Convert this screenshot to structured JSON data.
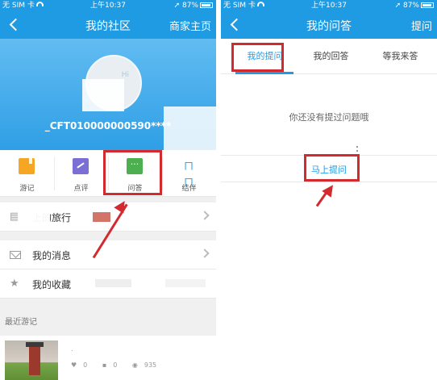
{
  "left_screen": {
    "status": {
      "carrier": "无 SIM 卡",
      "time": "上午10:37",
      "battery": "87%"
    },
    "nav": {
      "title": "我的社区",
      "right_action": "商家主页"
    },
    "profile": {
      "username": "_CFT010000000590****",
      "avatar_text": "Hi"
    },
    "grid": [
      {
        "label": "游记",
        "icon": "notes-icon"
      },
      {
        "label": "点评",
        "icon": "review-icon"
      },
      {
        "label": "问答",
        "icon": "qa-icon"
      },
      {
        "label": "结伴",
        "icon": "partner-icon"
      }
    ],
    "partner_icon_glyph": "ㄇㄇ",
    "list": [
      {
        "label": "上的旅行",
        "icon": "travel-icon"
      },
      {
        "label": "我的消息",
        "icon": "mail-icon"
      },
      {
        "label": "我的收藏",
        "icon": "star-icon"
      }
    ],
    "recent": {
      "section_title": "最近游记",
      "stats": {
        "likes": "0",
        "comments": "0",
        "views": "935"
      },
      "subtitle": "."
    }
  },
  "right_screen": {
    "status": {
      "carrier": "无 SIM 卡",
      "time": "上午10:37",
      "battery": "87%"
    },
    "nav": {
      "title": "我的问答",
      "right_action": "提问"
    },
    "tabs": [
      {
        "label": "我的提问",
        "active": true
      },
      {
        "label": "我的回答",
        "active": false
      },
      {
        "label": "等我来答",
        "active": false
      }
    ],
    "empty_message": "你还没有提过问题哦",
    "ask_button": "马上提问"
  },
  "colors": {
    "accent": "#1f9be4",
    "highlight": "#d32a2f"
  }
}
